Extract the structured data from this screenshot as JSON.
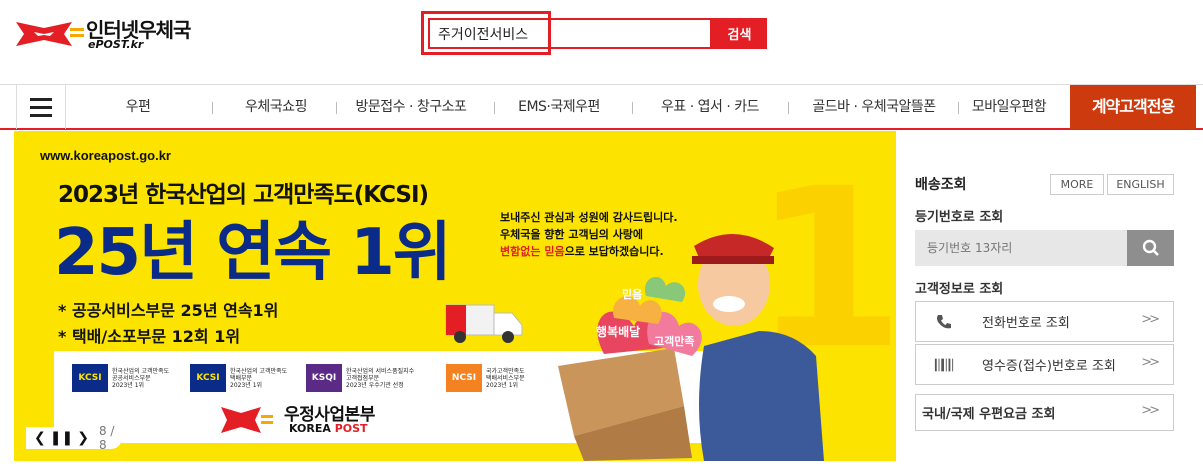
{
  "header": {
    "logo_text": "인터넷우체국",
    "logo_sub": "ePOST.kr",
    "search": {
      "value": "주거이전서비스",
      "button_label": "검색"
    }
  },
  "nav": {
    "items": [
      "우편",
      "우체국쇼핑",
      "방문접수 · 창구소포",
      "EMS·국제우편",
      "우표 · 엽서 · 카드",
      "골드바 · 우체국알뜰폰",
      "모바일우편함"
    ],
    "contract_label": "계약고객전용",
    "accent_color": "#e31e24",
    "contract_color": "#cc3a0e"
  },
  "banner": {
    "url": "www.koreapost.go.kr",
    "title": "2023년 한국산업의 고객만족도(KCSI)",
    "headline": "25년 연속 1위",
    "message_line1": "보내주신 관심과 성원에 감사드립니다.",
    "message_line2": "우체국을 향한 고객님의 사랑에",
    "message_line3_red1": "변함없는",
    "message_line3_red2": "믿음",
    "message_line3_rest": "으로 보답하겠습니다.",
    "bullet1": "* 공공서비스부문 25년 연속1위",
    "bullet2": "* 택배/소포부문 12회 1위",
    "awards": [
      {
        "logo": "KCSI",
        "text1": "한국산업의 고객만족도",
        "text2": "공공서비스부문",
        "text3": "2023년 1위"
      },
      {
        "logo": "KCSI",
        "text1": "한국산업의 고객만족도",
        "text2": "택배부문",
        "text3": "2023년 1위"
      },
      {
        "logo": "KSQI",
        "text1": "한국산업의 서비스품질지수",
        "text2": "고객접점부문",
        "text3": "2023년 우수기관 선정"
      },
      {
        "logo": "NCSI",
        "text1": "국가고객만족도",
        "text2": "택배서비스부문",
        "text3": "2023년 1위"
      }
    ],
    "org_name": "우정사업본부",
    "org_sub_a": "KOREA ",
    "org_sub_b": "POST",
    "heart_labels": [
      "믿음",
      "행복배달",
      "고객만족"
    ],
    "big_digit": "1",
    "page_indicator": "8 / 8",
    "background_color": "#fde400"
  },
  "tracking": {
    "title": "배송조회",
    "more_label": "MORE",
    "english_label": "ENGLISH",
    "reg_label": "등기번호로 조회",
    "reg_placeholder": "등기번호 13자리",
    "customer_label": "고객정보로 조회",
    "phone_button": "전화번호로 조회",
    "receipt_button": "영수증(접수)번호로 조회",
    "rates_button": "국내/국제 우편요금 조회"
  }
}
